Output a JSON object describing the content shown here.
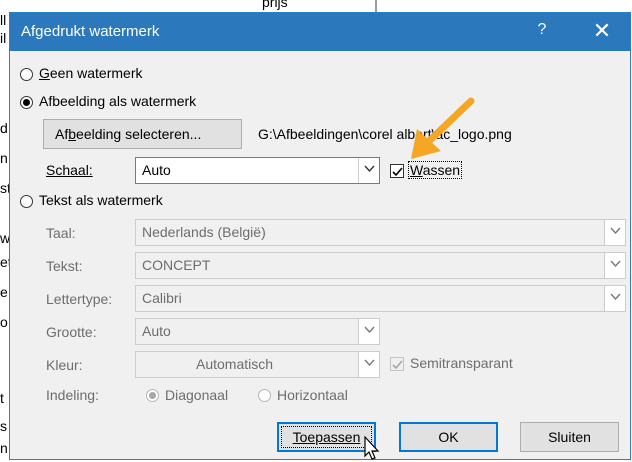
{
  "background_text": {
    "top_fragment": "prijs ",
    "left_chars": [
      "ll",
      "il",
      "d",
      "n",
      "st",
      "w",
      "et",
      "e",
      "o",
      "t",
      "s",
      "n"
    ]
  },
  "dialog": {
    "title": "Afgedrukt watermerk",
    "help_glyph": "?",
    "close_glyph": "✕",
    "options": {
      "none_label": "Geen watermerk",
      "picture_label": "Afbeelding als watermerk",
      "text_label": "Tekst als watermerk"
    },
    "picture": {
      "select_button": "Afbeelding selecteren...",
      "path": "G:\\Afbeeldingen\\corel albert\\ac_logo.png",
      "scale_label": "Schaal:",
      "scale_value": "Auto",
      "washout_label": "Wassen",
      "washout_checked": true
    },
    "text": {
      "language_label": "Taal:",
      "language_value": "Nederlands (België)",
      "text_label": "Tekst:",
      "text_value": "CONCEPT",
      "font_label": "Lettertype:",
      "font_value": "Calibri",
      "size_label": "Grootte:",
      "size_value": "Auto",
      "color_label": "Kleur:",
      "color_value": "Automatisch",
      "semitransparent_label": "Semitransparant",
      "semitransparent_checked": true,
      "layout_label": "Indeling:",
      "diagonal_label": "Diagonaal",
      "horizontal_label": "Horizontaal"
    },
    "buttons": {
      "apply": "Toepassen",
      "ok": "OK",
      "close": "Sluiten"
    }
  },
  "colors": {
    "titlebar": "#2b78bd",
    "arrow": "#f5a623"
  },
  "icons": {
    "annotation": "orange-arrow-icon",
    "cursor": "mouse-pointer-icon"
  }
}
